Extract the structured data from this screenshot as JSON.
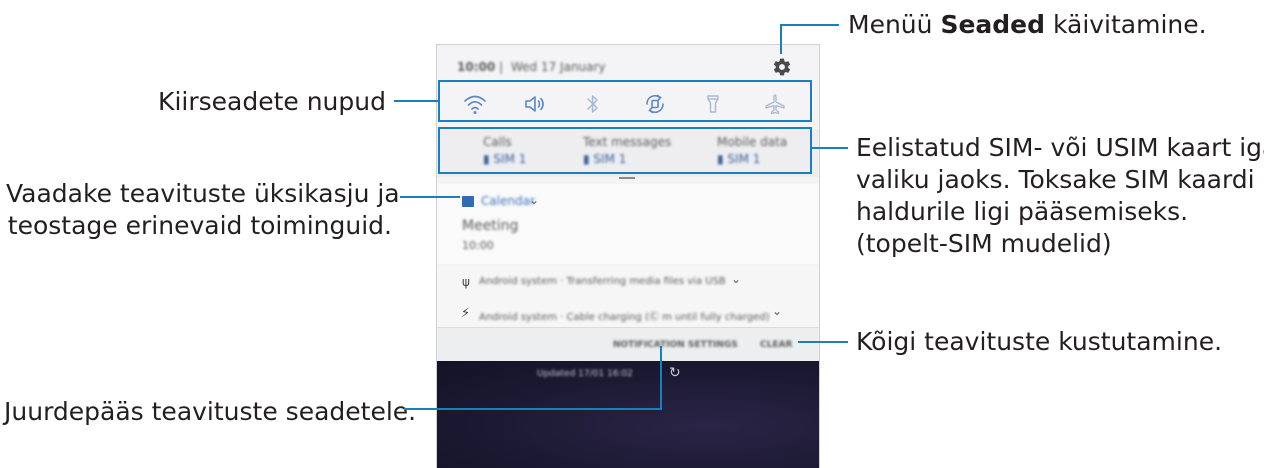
{
  "callouts": {
    "settings": {
      "prefix": "Menüü ",
      "bold": "Seaded",
      "suffix": " käivitamine."
    },
    "quick_buttons": "Kiirseadete nupud",
    "notification_details": [
      "Vaadake teavituste üksikasju ja",
      "teostage erinevaid toiminguid."
    ],
    "sim_preference": [
      "Eelistatud SIM- või USIM kaart iga",
      "valiku jaoks. Toksake SIM kaardi",
      "haldurile ligi pääsemiseks.",
      "(topelt-SIM mudelid)"
    ],
    "clear_all": "Kõigi teavituste kustutamine.",
    "notification_settings": "Juurdepääs teavituste seadetele."
  },
  "phone": {
    "status": {
      "time": "10:00",
      "date": "Wed 17 January"
    },
    "quick_icons": [
      "wifi-icon",
      "sound-icon",
      "bluetooth-icon",
      "auto-rotate-icon",
      "flashlight-icon",
      "airplane-icon"
    ],
    "sim_items": [
      {
        "label": "Calls",
        "sim": "SIM 1"
      },
      {
        "label": "Text messages",
        "sim": "SIM 1"
      },
      {
        "label": "Mobile data",
        "sim": "SIM 1"
      }
    ],
    "calendar": {
      "app": "Calendar",
      "title": "Meeting",
      "time": "10:00"
    },
    "android_notifs": [
      "Android system · Transferring media files via USB",
      "Android system · Cable charging (Ⓒ m until fully charged)"
    ],
    "actions": {
      "notification_settings": "NOTIFICATION SETTINGS",
      "clear": "CLEAR"
    },
    "lock_text": "Updated 17/01 16:02"
  },
  "colors": {
    "accent": "#1a7fc1",
    "icon": "#5b86c8"
  }
}
